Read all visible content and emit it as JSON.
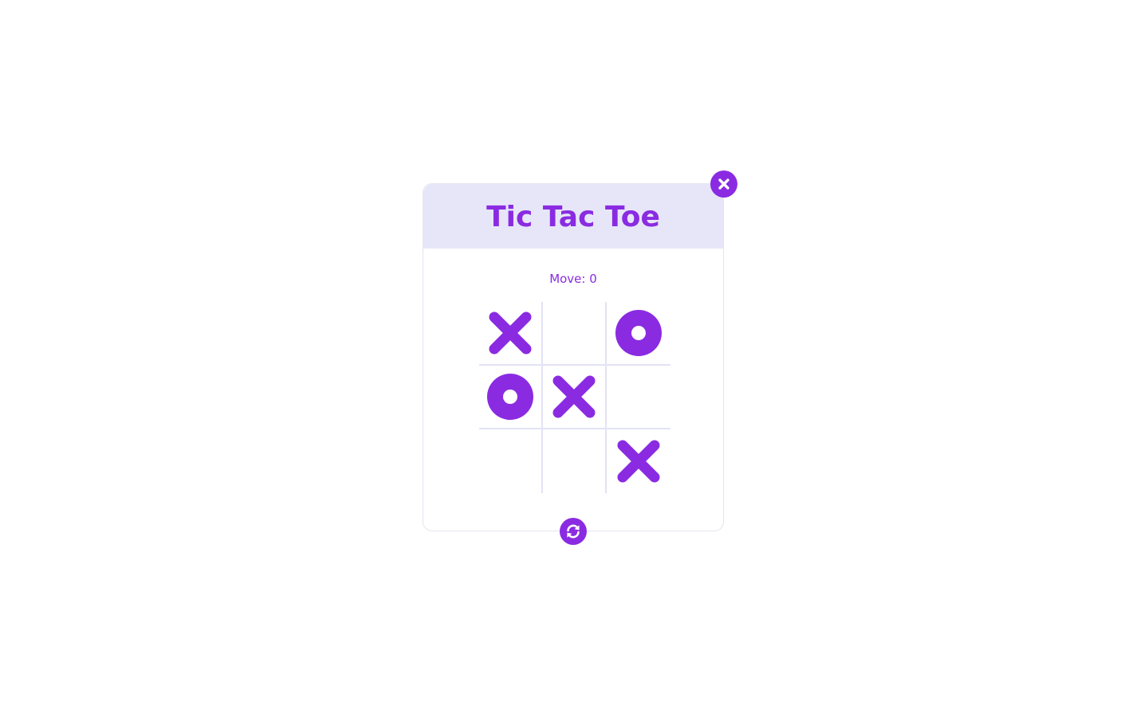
{
  "game": {
    "title": "Tic Tac Toe",
    "move_label": "Move:",
    "move_count": "0",
    "board": [
      [
        "X",
        "",
        "O"
      ],
      [
        "O",
        "X",
        ""
      ],
      [
        "",
        "",
        "X"
      ]
    ]
  },
  "controls": {
    "close_icon": "close-icon",
    "reset_icon": "refresh-icon"
  },
  "colors": {
    "accent": "#8a2be2",
    "header_bg": "#e6e6f8",
    "grid_line": "#e3e3f5"
  }
}
